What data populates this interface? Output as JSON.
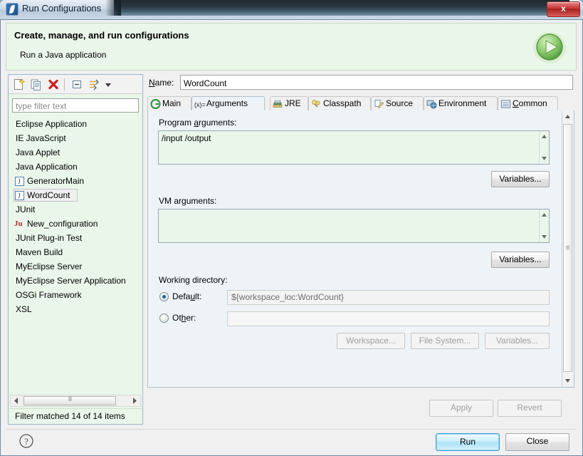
{
  "window": {
    "title": "Run Configurations",
    "app_icon": "eclipse-run-icon",
    "close_label": "x"
  },
  "header": {
    "title": "Create, manage, and run configurations",
    "subtitle": "Run a Java application",
    "badge_icon": "green-run-play-icon"
  },
  "left_panel": {
    "toolbar": [
      {
        "name": "new-configuration-icon",
        "tooltip": "New launch configuration"
      },
      {
        "name": "duplicate-configuration-icon",
        "tooltip": "Duplicate"
      },
      {
        "name": "delete-configuration-icon",
        "tooltip": "Delete"
      },
      {
        "name": "collapse-all-icon",
        "tooltip": "Collapse All"
      },
      {
        "name": "filter-launch-configurations-icon",
        "tooltip": "Filter"
      },
      {
        "name": "view-menu-chevron-icon",
        "tooltip": "View Menu"
      }
    ],
    "filter": {
      "placeholder": "type filter text",
      "value": ""
    },
    "tree": [
      {
        "label": "Eclipse Application",
        "icon": "",
        "indent": false,
        "selected": false
      },
      {
        "label": "IE JavaScript",
        "icon": "",
        "indent": false,
        "selected": false
      },
      {
        "label": "Java Applet",
        "icon": "",
        "indent": false,
        "selected": false
      },
      {
        "label": "Java Application",
        "icon": "",
        "indent": false,
        "selected": false
      },
      {
        "label": "GeneratorMain",
        "icon": "java-launch-icon",
        "indent": true,
        "selected": false
      },
      {
        "label": "WordCount",
        "icon": "java-launch-icon",
        "indent": true,
        "selected": true
      },
      {
        "label": "JUnit",
        "icon": "",
        "indent": false,
        "selected": false
      },
      {
        "label": "New_configuration",
        "icon": "junit-launch-icon",
        "indent": true,
        "selected": false
      },
      {
        "label": "JUnit Plug-in Test",
        "icon": "",
        "indent": false,
        "selected": false
      },
      {
        "label": "Maven Build",
        "icon": "",
        "indent": false,
        "selected": false
      },
      {
        "label": "MyEclipse Server",
        "icon": "",
        "indent": false,
        "selected": false
      },
      {
        "label": "MyEclipse Server Application",
        "icon": "",
        "indent": false,
        "selected": false
      },
      {
        "label": "OSGi Framework",
        "icon": "",
        "indent": false,
        "selected": false
      },
      {
        "label": "XSL",
        "icon": "",
        "indent": false,
        "selected": false
      }
    ],
    "filter_status": "Filter matched 14 of 14 items"
  },
  "right_panel": {
    "name_label": "Name:",
    "name_value": "WordCount",
    "tabs": [
      {
        "label": "Main",
        "icon": "main-tab-icon",
        "active": false
      },
      {
        "label": "Arguments",
        "icon": "arguments-tab-icon",
        "active": true
      },
      {
        "label": "JRE",
        "icon": "jre-tab-icon",
        "active": false
      },
      {
        "label": "Classpath",
        "icon": "classpath-tab-icon",
        "active": false
      },
      {
        "label": "Source",
        "icon": "source-tab-icon",
        "active": false
      },
      {
        "label": "Environment",
        "icon": "environment-tab-icon",
        "active": false
      },
      {
        "label": "Common",
        "icon": "common-tab-icon",
        "active": false
      }
    ],
    "program_arguments": {
      "label": "Program arguments:",
      "value": "/input /output",
      "variables_button": "Variables..."
    },
    "vm_arguments": {
      "label": "VM arguments:",
      "value": "",
      "variables_button": "Variables..."
    },
    "working_directory": {
      "label": "Working directory:",
      "default_radio_label": "Default:",
      "default_value": "${workspace_loc:WordCount}",
      "default_selected": true,
      "other_radio_label": "Other:",
      "other_value": "",
      "other_selected": false,
      "workspace_button": "Workspace...",
      "file_system_button": "File System...",
      "variables_button": "Variables..."
    }
  },
  "footer": {
    "apply_label": "Apply",
    "revert_label": "Revert",
    "help_icon": "help-question-icon",
    "run_label": "Run",
    "close_label": "Close"
  },
  "colors": {
    "header_bg": "#eaf6ea",
    "content_bg": "#eef3f8",
    "field_bg": "#eaf6ea",
    "accent_blue": "#3c9fd4",
    "delete_red": "#cc2222"
  }
}
